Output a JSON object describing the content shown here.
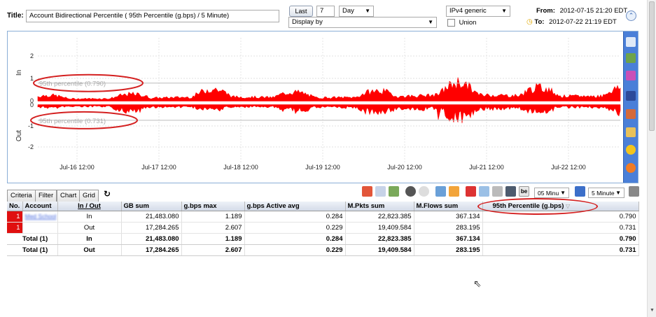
{
  "header": {
    "title_label": "Title:",
    "title_value": "Account Bidirectional Percentile ( 95th Percentile (g.bps) / 5 Minute)",
    "last_button": "Last",
    "last_count": "7",
    "period_unit": "Day",
    "display_by_placeholder": "Display by",
    "ip_version": "IPv4 generic",
    "union_label": "Union",
    "from_label": "From:",
    "from_value": "2012-07-15 21:20 EDT",
    "to_label": "To:",
    "to_value": "2012-07-22 21:19 EDT"
  },
  "chart": {
    "y_in_label": "In",
    "y_out_label": "Out",
    "y_ticks": [
      "2",
      "1",
      "0",
      "0",
      "-1",
      "-2"
    ],
    "x_ticks": [
      "Jul-16 12:00",
      "Jul-17 12:00",
      "Jul-18 12:00",
      "Jul-19 12:00",
      "Jul-20 12:00",
      "Jul-21 12:00",
      "Jul-22 12:00"
    ],
    "percentile_in_label": "95th percentile (0.790)",
    "percentile_out_label": "95th percentile (0.731)",
    "series_color": "#ff0000"
  },
  "chart_data": {
    "type": "area",
    "x": [
      "Jul-16 12:00",
      "Jul-17 12:00",
      "Jul-18 12:00",
      "Jul-19 12:00",
      "Jul-20 12:00",
      "Jul-21 12:00",
      "Jul-22 12:00"
    ],
    "series": [
      {
        "name": "In",
        "values": [
          0.25,
          0.3,
          0.55,
          0.4,
          0.45,
          0.85,
          0.6
        ]
      },
      {
        "name": "Out",
        "values": [
          -0.15,
          -0.4,
          -0.3,
          -0.35,
          -0.5,
          -0.8,
          -0.4
        ]
      }
    ],
    "ylabel": "In / Out",
    "ylim": [
      -2.5,
      2.5
    ],
    "percentile_in": 0.79,
    "percentile_out": -0.731,
    "grid": true
  },
  "tabs": [
    "Criteria",
    "Filter",
    "Chart",
    "Grid"
  ],
  "toolbar": {
    "resolution_select": "05 Minu",
    "interval_select": "5 Minute"
  },
  "table": {
    "columns": [
      "No.",
      "Account",
      "In / Out",
      "GB sum",
      "g.bps max",
      "g.bps Active avg",
      "M.Pkts sum",
      "M.Flows sum",
      "95th Percentile (g.bps)"
    ],
    "rows": [
      {
        "no": "1",
        "account": "Med School",
        "dir": "In",
        "gb_sum": "21,483.080",
        "gbps_max": "1.189",
        "gbps_avg": "0.284",
        "mpkts": "22,823.385",
        "mflows": "367.134",
        "pct95": "0.790"
      },
      {
        "no": "1",
        "account": "",
        "dir": "Out",
        "gb_sum": "17,284.265",
        "gbps_max": "2.607",
        "gbps_avg": "0.229",
        "mpkts": "19,409.584",
        "mflows": "283.195",
        "pct95": "0.731"
      }
    ],
    "totals": [
      {
        "label": "Total (1)",
        "dir": "In",
        "gb_sum": "21,483.080",
        "gbps_max": "1.189",
        "gbps_avg": "0.284",
        "mpkts": "22,823.385",
        "mflows": "367.134",
        "pct95": "0.790"
      },
      {
        "label": "Total (1)",
        "dir": "Out",
        "gb_sum": "17,284.265",
        "gbps_max": "2.607",
        "gbps_avg": "0.229",
        "mpkts": "19,409.584",
        "mflows": "283.195",
        "pct95": "0.731"
      }
    ]
  }
}
